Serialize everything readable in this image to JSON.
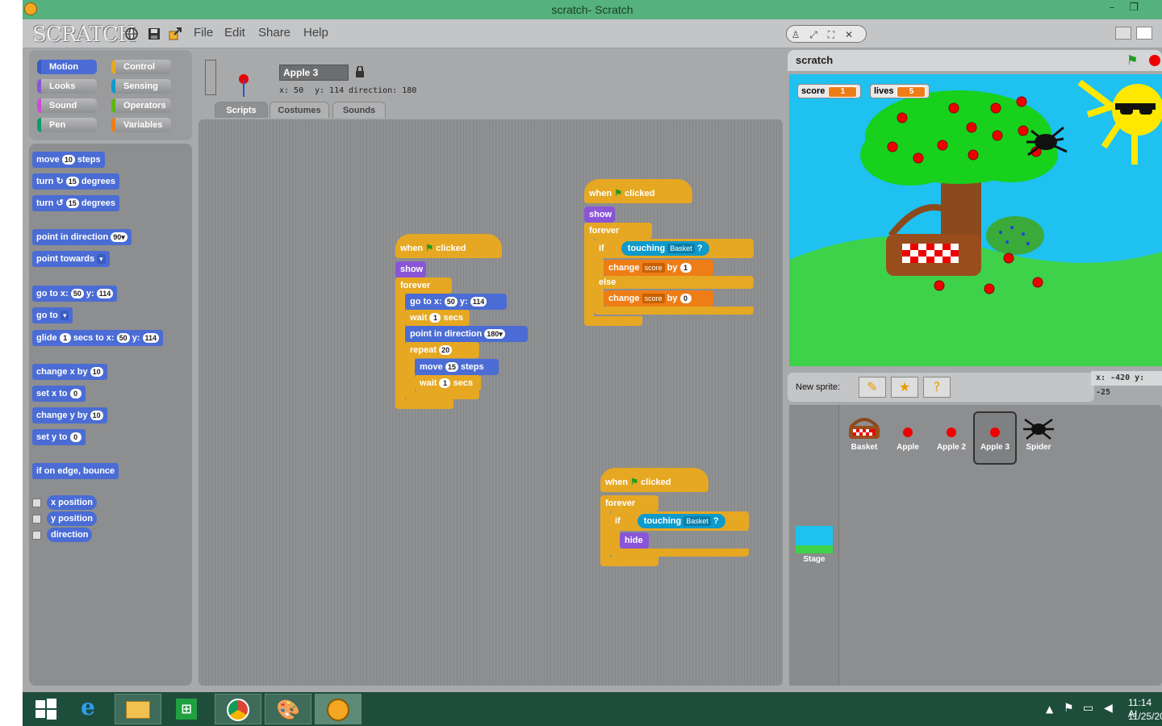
{
  "window": {
    "title": "scratch- Scratch",
    "minimize": "–",
    "restore": "❐"
  },
  "menubar": {
    "logo": "SCRATCH",
    "items": [
      "File",
      "Edit",
      "Share",
      "Help"
    ],
    "icons": [
      "globe-icon",
      "save-icon",
      "share-icon"
    ]
  },
  "categories": [
    {
      "label": "Motion",
      "color": "#4a6cd4"
    },
    {
      "label": "Control",
      "color": "#e6a822"
    },
    {
      "label": "Looks",
      "color": "#8a55d7"
    },
    {
      "label": "Sensing",
      "color": "#0e9acb"
    },
    {
      "label": "Sound",
      "color": "#cf4ad9"
    },
    {
      "label": "Operators",
      "color": "#5cb712"
    },
    {
      "label": "Pen",
      "color": "#0e9a6c"
    },
    {
      "label": "Variables",
      "color": "#ee7d16"
    }
  ],
  "palette": {
    "move": {
      "a": "move",
      "v": "10",
      "b": "steps"
    },
    "turn_cw": {
      "a": "turn",
      "v": "15",
      "b": "degrees"
    },
    "turn_ccw": {
      "a": "turn",
      "v": "15",
      "b": "degrees"
    },
    "point_dir": {
      "a": "point in direction",
      "v": "90▾"
    },
    "point_towards": {
      "a": "point towards"
    },
    "goto_xy": {
      "a": "go to x:",
      "x": "50",
      "b": "y:",
      "y": "114"
    },
    "goto": {
      "a": "go to"
    },
    "glide": {
      "a": "glide",
      "s": "1",
      "b": "secs to x:",
      "x": "50",
      "c": "y:",
      "y": "114"
    },
    "change_x": {
      "a": "change x by",
      "v": "10"
    },
    "set_x": {
      "a": "set x to",
      "v": "0"
    },
    "change_y": {
      "a": "change y by",
      "v": "10"
    },
    "set_y": {
      "a": "set y to",
      "v": "0"
    },
    "bounce": {
      "a": "if on edge, bounce"
    },
    "xpos": "x position",
    "ypos": "y position",
    "direction": "direction"
  },
  "sprite": {
    "name": "Apple 3",
    "x": "x: 50",
    "y": "y: 114",
    "direction": "direction:  180"
  },
  "tabs": [
    "Scripts",
    "Costumes",
    "Sounds"
  ],
  "scriptA": {
    "when": "when",
    "clicked": "clicked",
    "show": "show",
    "forever": "forever",
    "goto": "go to x:",
    "gx": "50",
    "gy_label": "y:",
    "gy": "114",
    "wait": "wait",
    "wv": "1",
    "secs": "secs",
    "point": "point in direction",
    "pv": "180▾",
    "repeat": "repeat",
    "rv": "20",
    "move": "move",
    "mv": "15",
    "steps": "steps",
    "wait2": "wait",
    "wv2": "1",
    "secs2": "secs"
  },
  "scriptB": {
    "when": "when",
    "clicked": "clicked",
    "show": "show",
    "forever": "forever",
    "if": "if",
    "touching": "touching",
    "basket": "Basket",
    "q": "?",
    "change1": "change",
    "var1": "score",
    "by1": "by",
    "val1": "1",
    "else": "else",
    "change2": "change",
    "var2": "score",
    "by2": "by",
    "val2": "0"
  },
  "scriptC": {
    "when": "when",
    "clicked": "clicked",
    "forever": "forever",
    "if": "if",
    "touching": "touching",
    "basket": "Basket",
    "q": "?",
    "hide": "hide"
  },
  "stage": {
    "title": "scratch",
    "monitors": [
      {
        "label": "score",
        "value": "1"
      },
      {
        "label": "lives",
        "value": "5"
      }
    ],
    "coords": "x: -420   y: -25"
  },
  "newsprite": {
    "label": "New sprite:"
  },
  "sprites": [
    {
      "name": "Basket",
      "selected": false
    },
    {
      "name": "Apple",
      "selected": false
    },
    {
      "name": "Apple 2",
      "selected": false
    },
    {
      "name": "Apple 3",
      "selected": true
    },
    {
      "name": "Spider",
      "selected": false
    }
  ],
  "stageThumb": "Stage",
  "taskbar": {
    "time": "11:14 AI",
    "date": "11/25/20"
  }
}
